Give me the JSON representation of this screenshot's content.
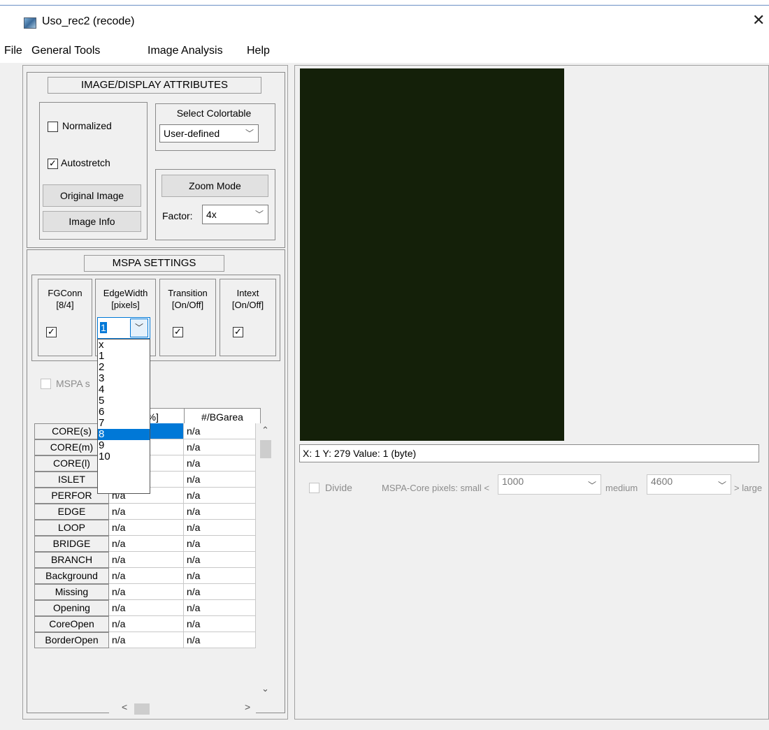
{
  "window": {
    "title": "Uso_rec2 (recode)",
    "close_symbol": "✕"
  },
  "menu": [
    "File",
    "General Tools",
    "Image Analysis",
    "Help"
  ],
  "image_display": {
    "title": "IMAGE/DISPLAY ATTRIBUTES",
    "normalized_label": "Normalized",
    "normalized_checked": false,
    "autostretch_label": "Autostretch",
    "autostretch_checked": true,
    "original_image_button": "Original Image",
    "image_info_button": "Image Info",
    "colortable_label": "Select Colortable",
    "colortable_value": "User-defined",
    "zoom_mode_button": "Zoom Mode",
    "factor_label": "Factor:",
    "factor_value": "4x"
  },
  "mspa": {
    "title": "MSPA SETTINGS",
    "fgconn_label": "FGConn",
    "fgconn_sub": "[8/4]",
    "edgewidth_label": "EdgeWidth",
    "edgewidth_sub": "[pixels]",
    "edgewidth_value": "1",
    "transition_label": "Transition",
    "transition_sub": "[On/Off]",
    "intext_label": "Intext",
    "intext_sub": "[On/Off]",
    "mspa_s_label": "MSPA s",
    "edgewidth_options": [
      "x",
      "1",
      "2",
      "3",
      "4",
      "5",
      "6",
      "7",
      "8",
      "9",
      "10"
    ],
    "edgewidth_highlighted": "8"
  },
  "table": {
    "col2_header": "ta[%]",
    "col3_header": "#/BGarea",
    "rows": [
      {
        "label": "CORE(s)",
        "v1": "",
        "v2": "n/a"
      },
      {
        "label": "CORE(m)",
        "v1": "",
        "v2": "n/a"
      },
      {
        "label": "CORE(l)",
        "v1": "",
        "v2": "n/a"
      },
      {
        "label": "ISLET",
        "v1": "n/a",
        "v2": "n/a"
      },
      {
        "label": "PERFOR",
        "v1": "n/a",
        "v2": "n/a"
      },
      {
        "label": "EDGE",
        "v1": "n/a",
        "v2": "n/a"
      },
      {
        "label": "LOOP",
        "v1": "n/a",
        "v2": "n/a"
      },
      {
        "label": "BRIDGE",
        "v1": "n/a",
        "v2": "n/a"
      },
      {
        "label": "BRANCH",
        "v1": "n/a",
        "v2": "n/a"
      },
      {
        "label": "Background",
        "v1": "n/a",
        "v2": "n/a"
      },
      {
        "label": "Missing",
        "v1": "n/a",
        "v2": "n/a"
      },
      {
        "label": "Opening",
        "v1": "n/a",
        "v2": "n/a"
      },
      {
        "label": "CoreOpen",
        "v1": "n/a",
        "v2": "n/a"
      },
      {
        "label": "BorderOpen",
        "v1": "n/a",
        "v2": "n/a"
      }
    ]
  },
  "viewer": {
    "status": "X: 1   Y: 279   Value: 1 (byte)",
    "divide_label": "Divide",
    "core_pixels_label": "MSPA-Core pixels:  small <",
    "small_value": "1000",
    "medium_label": "medium",
    "medium_value": "4600",
    "large_label": "> large",
    "canvas_color": "#142009"
  }
}
